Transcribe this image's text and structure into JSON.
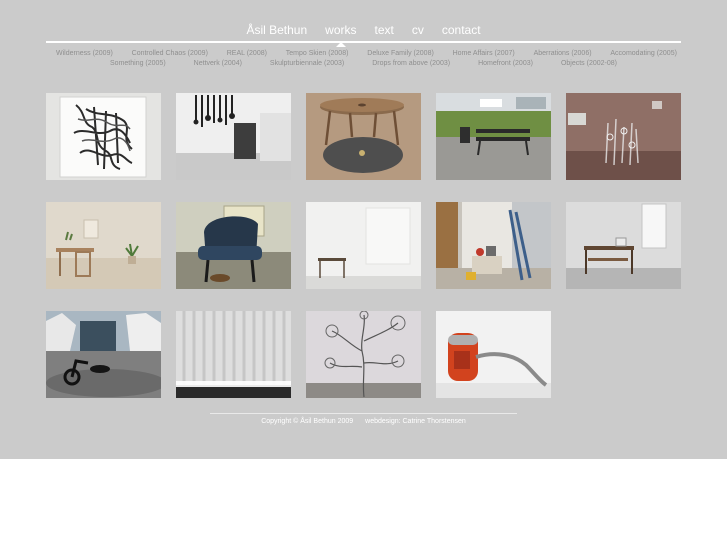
{
  "nav": {
    "site_title": "Åsil Bethun",
    "items": [
      "works",
      "text",
      "cv",
      "contact"
    ],
    "active": "works"
  },
  "works_menu": {
    "row1": [
      "Wilderness (2009)",
      "Controlled Chaos (2009)",
      "REAL (2008)",
      "Tempo Skien (2008)",
      "Deluxe Family (2008)",
      "Home Affairs (2007)",
      "Aberrations (2006)",
      "Accomodating (2005)"
    ],
    "row2": [
      "Something (2005)",
      "Nettverk (2004)",
      "Skulpturbiennale (2003)",
      "Drops from above (2003)",
      "Homefront (2003)",
      "Objects (2002-08)"
    ]
  },
  "thumbnails": [
    {
      "name": "thumb-ink-drawing",
      "icon": "ink-drawing-image"
    },
    {
      "name": "thumb-gallery-hanging",
      "icon": "gallery-hanging-objects-image"
    },
    {
      "name": "thumb-round-table",
      "icon": "round-table-image"
    },
    {
      "name": "thumb-park-bench",
      "icon": "park-bench-image"
    },
    {
      "name": "thumb-glass-installation",
      "icon": "glass-installation-image"
    },
    {
      "name": "thumb-miniature-room",
      "icon": "miniature-room-image"
    },
    {
      "name": "thumb-armchair",
      "icon": "armchair-image"
    },
    {
      "name": "thumb-white-wall-stool",
      "icon": "white-wall-stool-image"
    },
    {
      "name": "thumb-cluttered-corridor",
      "icon": "cluttered-corridor-image"
    },
    {
      "name": "thumb-corner-table",
      "icon": "corner-table-image"
    },
    {
      "name": "thumb-exercise-bike",
      "icon": "exercise-bike-image"
    },
    {
      "name": "thumb-curtain-light",
      "icon": "curtain-light-image"
    },
    {
      "name": "thumb-floral-wall-drawing",
      "icon": "floral-wall-drawing-image"
    },
    {
      "name": "thumb-vacuum-cleaner",
      "icon": "vacuum-cleaner-image"
    }
  ],
  "footer": {
    "copyright": "Copyright © Åsil Bethun 2009",
    "webdesign": "webdesign: Catrine Thorstensen"
  },
  "colors": {
    "panel_bg": "#cbcbcb",
    "nav_text": "#ffffff",
    "submenu_text": "#8f8f8f",
    "page_bg": "#ffffff"
  }
}
